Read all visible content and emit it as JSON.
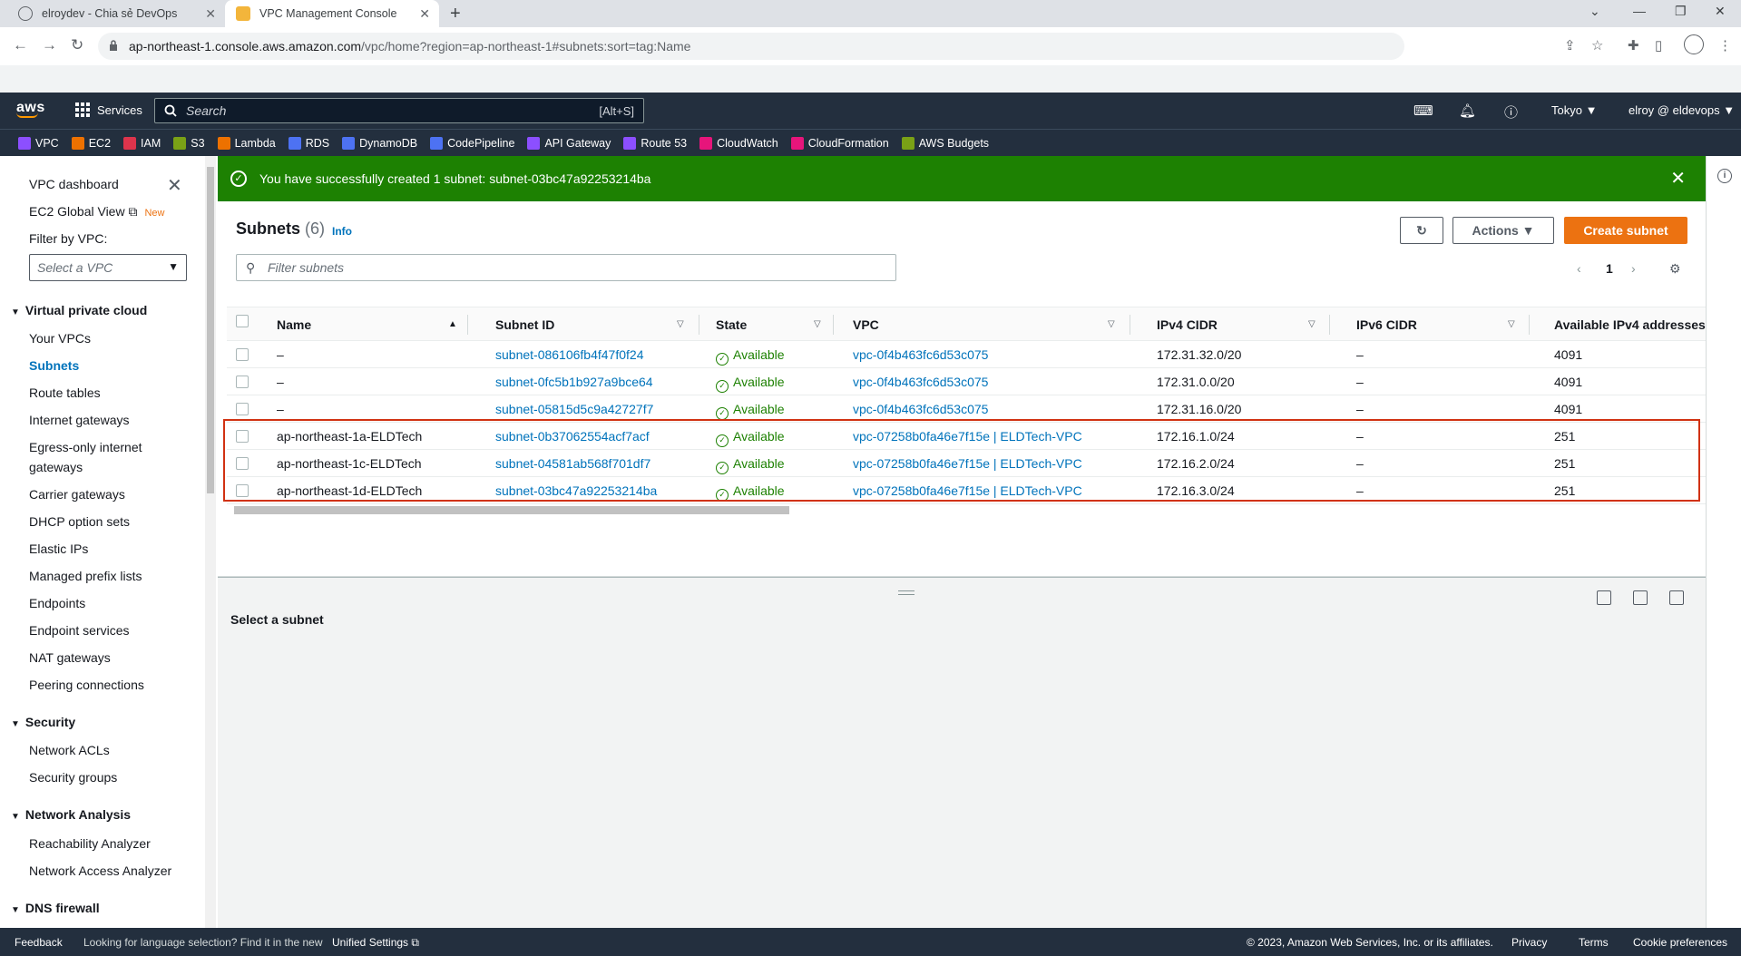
{
  "browser": {
    "tabs": [
      {
        "title": "elroydev - Chia sẻ DevOps",
        "active": false
      },
      {
        "title": "VPC Management Console",
        "active": true
      }
    ],
    "url_host": "ap-northeast-1.console.aws.amazon.com",
    "url_path": "/vpc/home?region=ap-northeast-1#subnets:sort=tag:Name"
  },
  "aws_header": {
    "logo": "aws",
    "services_label": "Services",
    "search_placeholder": "Search",
    "search_shortcut": "[Alt+S]",
    "region": "Tokyo ▼",
    "account": "elroy @ eldevops ▼"
  },
  "favorites": [
    {
      "label": "VPC",
      "color": "#8c4fff"
    },
    {
      "label": "EC2",
      "color": "#ed7100"
    },
    {
      "label": "IAM",
      "color": "#dd344c"
    },
    {
      "label": "S3",
      "color": "#7aa116"
    },
    {
      "label": "Lambda",
      "color": "#ed7100"
    },
    {
      "label": "RDS",
      "color": "#4d72f3"
    },
    {
      "label": "DynamoDB",
      "color": "#4d72f3"
    },
    {
      "label": "CodePipeline",
      "color": "#4d72f3"
    },
    {
      "label": "API Gateway",
      "color": "#8c4fff"
    },
    {
      "label": "Route 53",
      "color": "#8c4fff"
    },
    {
      "label": "CloudWatch",
      "color": "#e7157b"
    },
    {
      "label": "CloudFormation",
      "color": "#e7157b"
    },
    {
      "label": "AWS Budgets",
      "color": "#7aa116"
    }
  ],
  "sidebar": {
    "dashboard": "VPC dashboard",
    "global_view": "EC2 Global View",
    "new_badge": "New",
    "filter_label": "Filter by VPC:",
    "filter_placeholder": "Select a VPC",
    "sections": [
      {
        "title": "Virtual private cloud",
        "items": [
          "Your VPCs",
          "Subnets",
          "Route tables",
          "Internet gateways",
          "Egress-only internet",
          "gateways",
          "Carrier gateways",
          "DHCP option sets",
          "Elastic IPs",
          "Managed prefix lists",
          "Endpoints",
          "Endpoint services",
          "NAT gateways",
          "Peering connections"
        ]
      },
      {
        "title": "Security",
        "items": [
          "Network ACLs",
          "Security groups"
        ]
      },
      {
        "title": "Network Analysis",
        "items": [
          "Reachability Analyzer",
          "Network Access Analyzer"
        ]
      },
      {
        "title": "DNS firewall",
        "items": []
      }
    ]
  },
  "flash": {
    "message": "You have successfully created 1 subnet: subnet-03bc47a92253214ba"
  },
  "subnets": {
    "title": "Subnets",
    "count": "(6)",
    "info": "Info",
    "actions_label": "Actions ▼",
    "create_label": "Create subnet",
    "filter_placeholder": "Filter subnets",
    "page": "1",
    "columns": [
      "Name",
      "Subnet ID",
      "State",
      "VPC",
      "IPv4 CIDR",
      "IPv6 CIDR",
      "Available IPv4 addresses"
    ],
    "rows": [
      {
        "name": "–",
        "id": "subnet-086106fb4f47f0f24",
        "state": "Available",
        "vpc": "vpc-0f4b463fc6d53c075",
        "ipv4": "172.31.32.0/20",
        "ipv6": "–",
        "avail": "4091"
      },
      {
        "name": "–",
        "id": "subnet-0fc5b1b927a9bce64",
        "state": "Available",
        "vpc": "vpc-0f4b463fc6d53c075",
        "ipv4": "172.31.0.0/20",
        "ipv6": "–",
        "avail": "4091"
      },
      {
        "name": "–",
        "id": "subnet-05815d5c9a42727f7",
        "state": "Available",
        "vpc": "vpc-0f4b463fc6d53c075",
        "ipv4": "172.31.16.0/20",
        "ipv6": "–",
        "avail": "4091"
      },
      {
        "name": "ap-northeast-1a-ELDTech",
        "id": "subnet-0b37062554acf7acf",
        "state": "Available",
        "vpc": "vpc-07258b0fa46e7f15e | ELDTech-VPC",
        "ipv4": "172.16.1.0/24",
        "ipv6": "–",
        "avail": "251"
      },
      {
        "name": "ap-northeast-1c-ELDTech",
        "id": "subnet-04581ab568f701df7",
        "state": "Available",
        "vpc": "vpc-07258b0fa46e7f15e | ELDTech-VPC",
        "ipv4": "172.16.2.0/24",
        "ipv6": "–",
        "avail": "251"
      },
      {
        "name": "ap-northeast-1d-ELDTech",
        "id": "subnet-03bc47a92253214ba",
        "state": "Available",
        "vpc": "vpc-07258b0fa46e7f15e | ELDTech-VPC",
        "ipv4": "172.16.3.0/24",
        "ipv6": "–",
        "avail": "251"
      }
    ]
  },
  "details": {
    "empty_text": "Select a subnet"
  },
  "footer": {
    "feedback": "Feedback",
    "lang_prompt": "Looking for language selection? Find it in the new",
    "unified": "Unified Settings",
    "copyright": "© 2023, Amazon Web Services, Inc. or its affiliates.",
    "privacy": "Privacy",
    "terms": "Terms",
    "cookies": "Cookie preferences"
  }
}
